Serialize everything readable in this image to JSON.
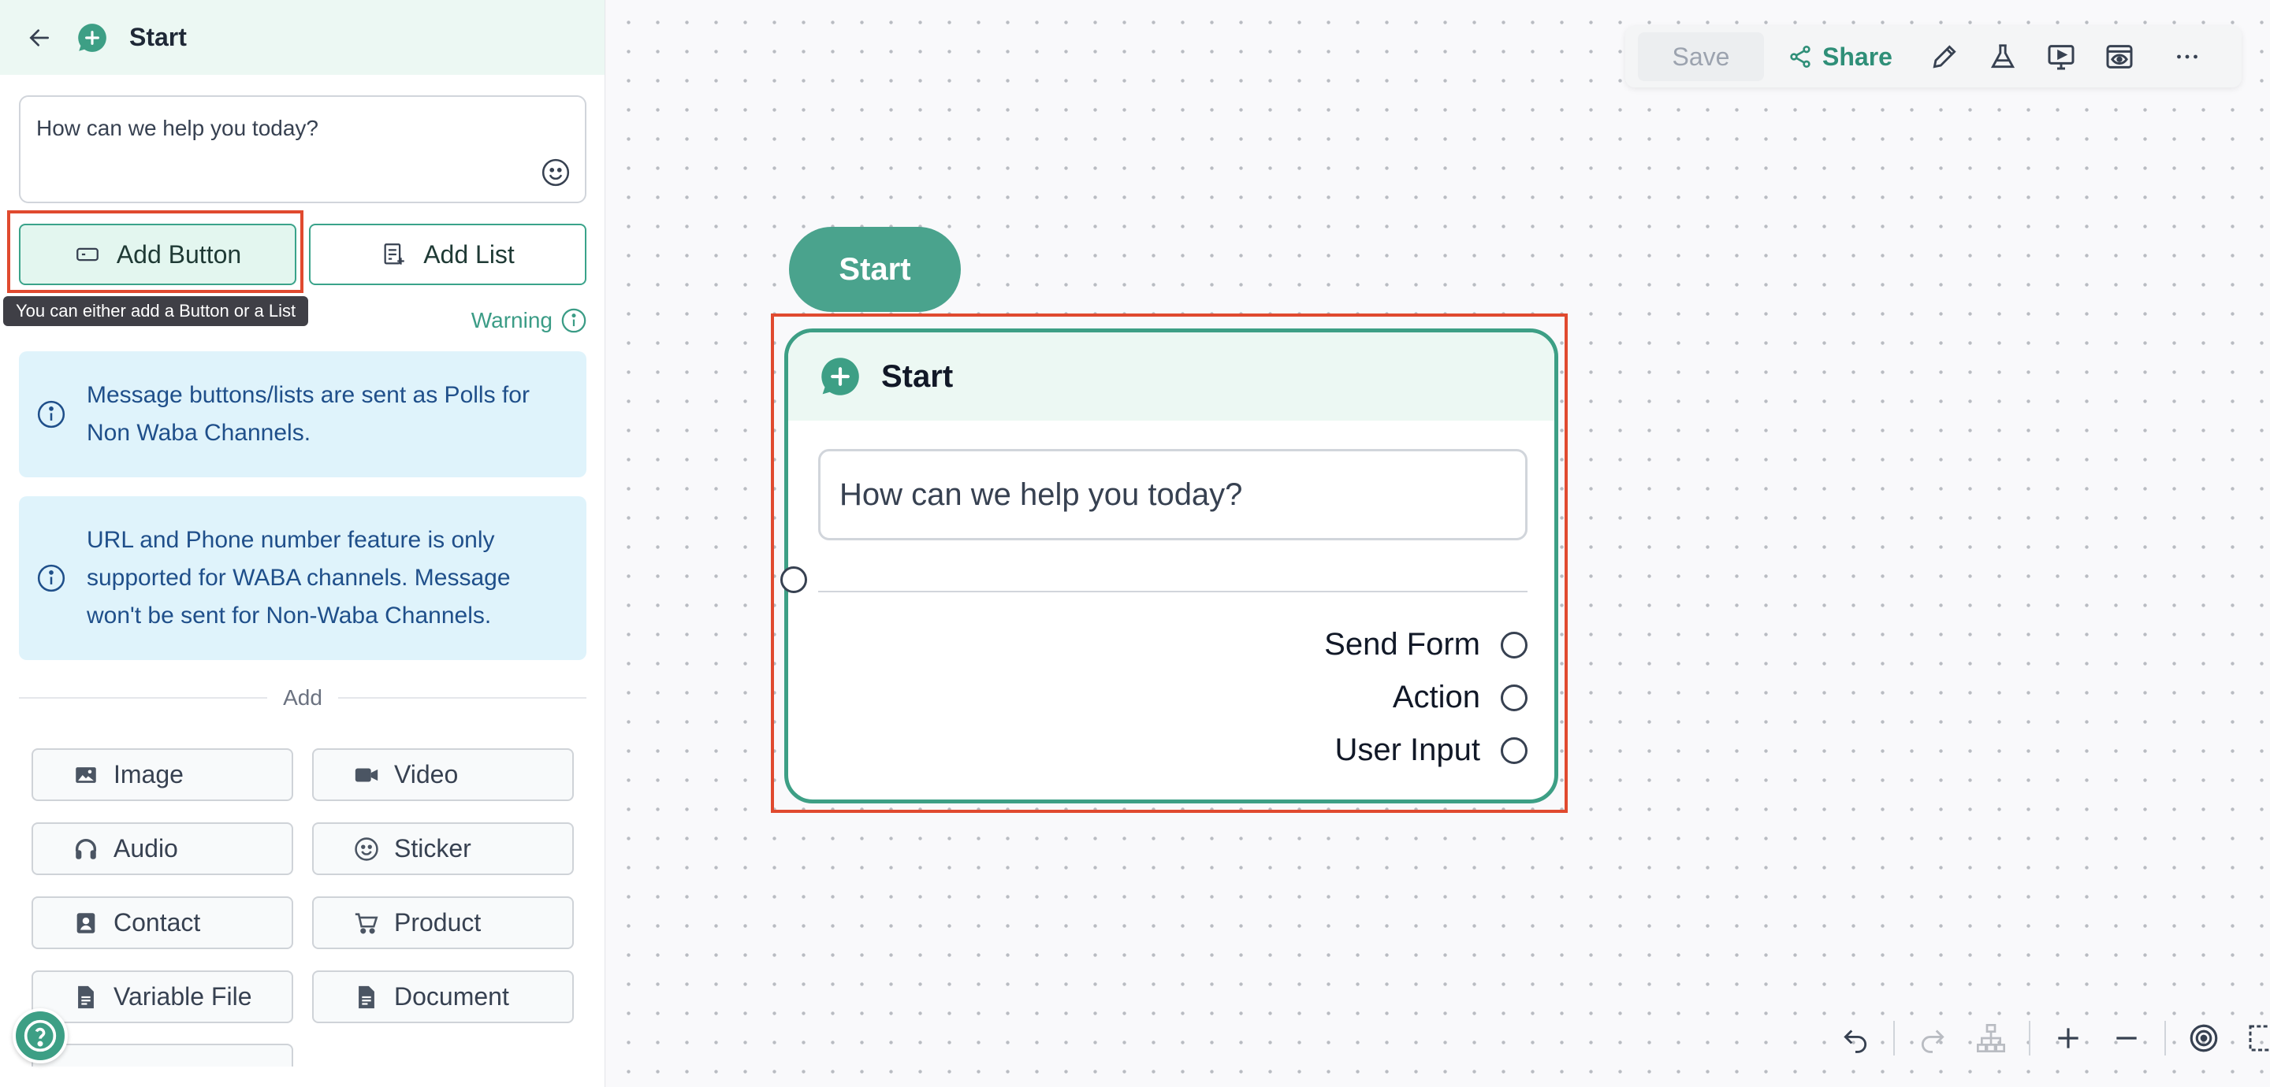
{
  "panel": {
    "title": "Start",
    "message_text": "How can we help you today?",
    "add_button_label": "Add Button",
    "add_list_label": "Add List",
    "tooltip": "You can either add a Button or a List",
    "warning_label": "Warning",
    "info_one": "Message buttons/lists are sent as Polls for Non Waba Channels.",
    "info_two": "URL and Phone number feature is only supported for WABA channels. Message won't be sent for Non-Waba Channels.",
    "add_divider_label": "Add",
    "media_buttons": [
      {
        "label": "Image",
        "icon": "image-icon"
      },
      {
        "label": "Video",
        "icon": "video-icon"
      },
      {
        "label": "Audio",
        "icon": "headphones-icon"
      },
      {
        "label": "Sticker",
        "icon": "sticker-icon"
      },
      {
        "label": "Contact",
        "icon": "contact-icon"
      },
      {
        "label": "Product",
        "icon": "cart-icon"
      },
      {
        "label": "Variable File",
        "icon": "file-icon"
      },
      {
        "label": "Document",
        "icon": "document-icon"
      }
    ]
  },
  "toolbar": {
    "save_label": "Save",
    "share_label": "Share",
    "icons": [
      "edit-icon",
      "flask-icon",
      "preview-icon",
      "eye-icon",
      "more-icon"
    ]
  },
  "canvas": {
    "start_pill_label": "Start",
    "node": {
      "title": "Start",
      "message": "How can we help you today?",
      "options": [
        "Send Form",
        "Action",
        "User Input"
      ]
    }
  },
  "colors": {
    "accent": "#3d9f85",
    "highlight": "#e04a2f",
    "info_bg": "#dff3fb",
    "info_text": "#1f4f8a"
  }
}
